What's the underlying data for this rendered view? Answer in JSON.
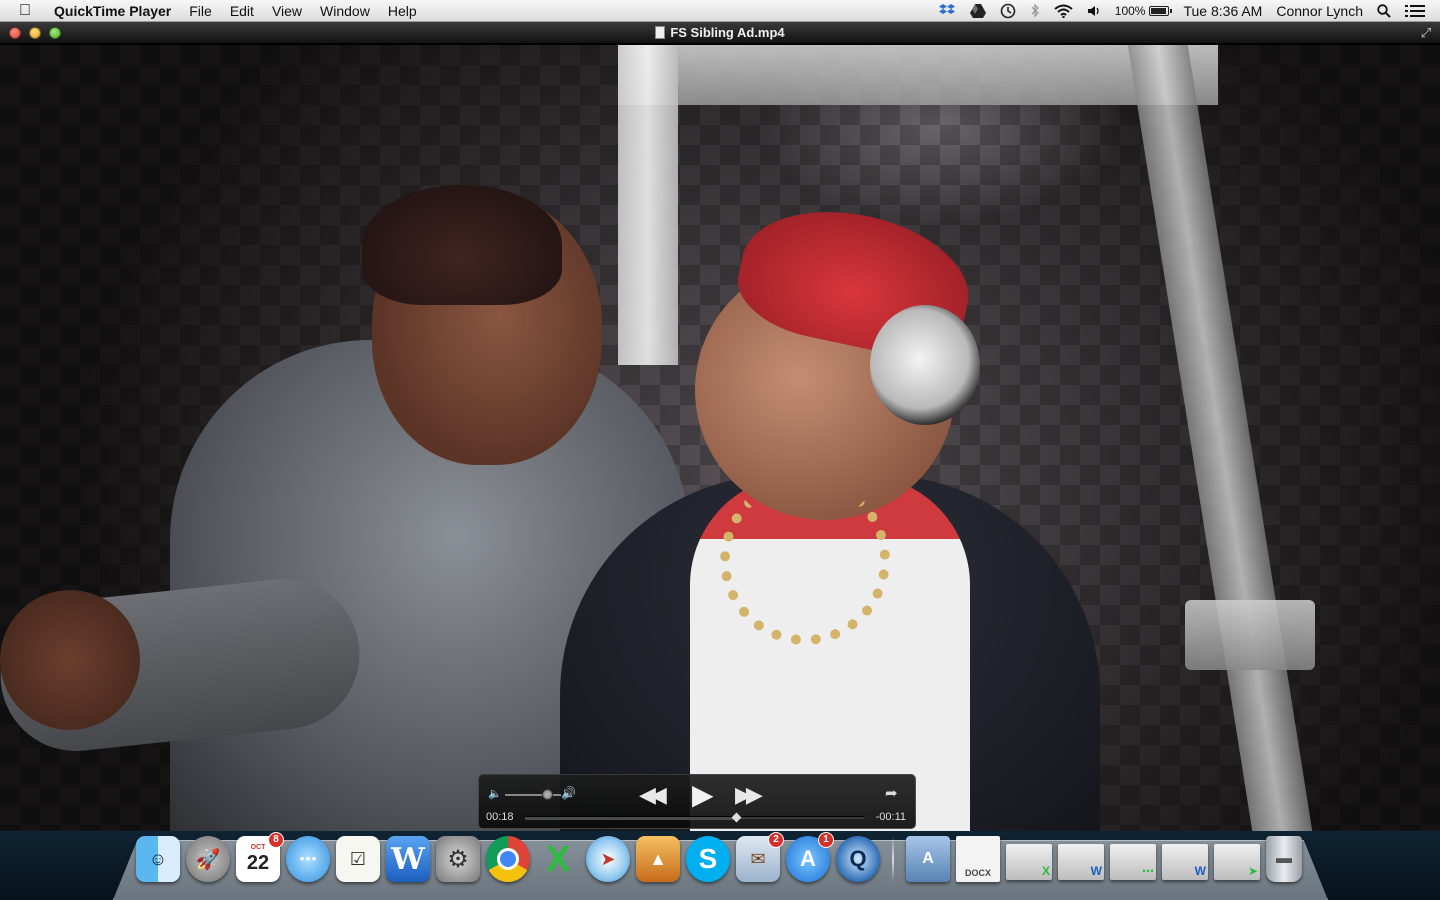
{
  "menubar": {
    "apple_icon": "apple-logo-icon",
    "app_name": "QuickTime Player",
    "menus": [
      "File",
      "Edit",
      "View",
      "Window",
      "Help"
    ],
    "status": {
      "dropbox_icon": "dropbox-icon",
      "drive_icon": "google-drive-icon",
      "time_machine_icon": "time-machine-icon",
      "bluetooth_icon": "bluetooth-icon",
      "wifi_icon": "wifi-icon",
      "volume_icon": "volume-icon",
      "battery_percent": "100%",
      "battery_level": 1.0,
      "clock": "Tue 8:36 AM",
      "user": "Connor Lynch",
      "spotlight_icon": "spotlight-search-icon",
      "notifications_icon": "notification-center-icon"
    }
  },
  "window": {
    "title": "FS Sibling Ad.mp4"
  },
  "player": {
    "elapsed": "00:18",
    "remaining": "-00:11",
    "progress": 0.62,
    "volume_level": 0.75
  },
  "dock": {
    "calendar_month": "OCT",
    "calendar_day": "22",
    "calendar_badge": "8",
    "mail_badge": "2",
    "appstore_badge": "1",
    "docx_label": "DOCX"
  }
}
